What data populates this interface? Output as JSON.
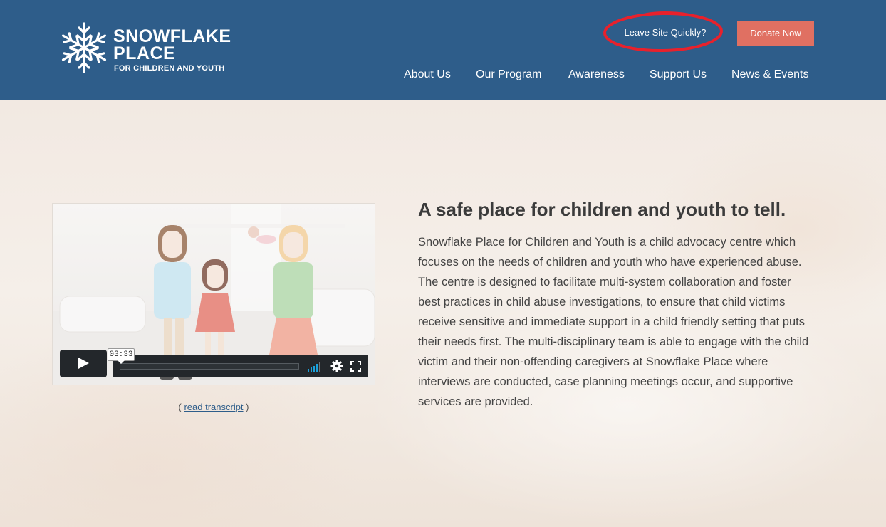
{
  "header": {
    "logo": {
      "line1": "SNOWFLAKE",
      "line2": "PLACE",
      "line3": "FOR CHILDREN AND YOUTH"
    },
    "leave_site": "Leave Site Quickly?",
    "donate": "Donate Now",
    "nav": [
      "About Us",
      "Our Program",
      "Awareness",
      "Support Us",
      "News & Events"
    ]
  },
  "hero": {
    "video": {
      "duration": "03:33",
      "icons": [
        "play-icon",
        "volume-icon",
        "gear-icon",
        "fullscreen-icon"
      ]
    },
    "transcript": {
      "open": "(",
      "link": "read transcript",
      "close": ")"
    },
    "headline": "A safe place for children and youth to tell.",
    "body": "Snowflake Place for Children and Youth is a child advocacy centre which focuses on the needs of children and youth who have experienced abuse. The centre is designed to facilitate multi-system collaboration and foster best practices in child abuse investigations, to ensure that child victims receive sensitive and immediate support in a child friendly setting that puts their needs first. The multi-disciplinary team is able to engage with the child victim and their non-offending caregivers at Snowflake Place where interviews are conducted, case planning meetings occur, and supportive services are provided."
  },
  "colors": {
    "header_bg": "#2e5d8a",
    "donate_bg": "#e07062",
    "annotation_circle": "#e8212c",
    "link": "#2e5d8a"
  }
}
